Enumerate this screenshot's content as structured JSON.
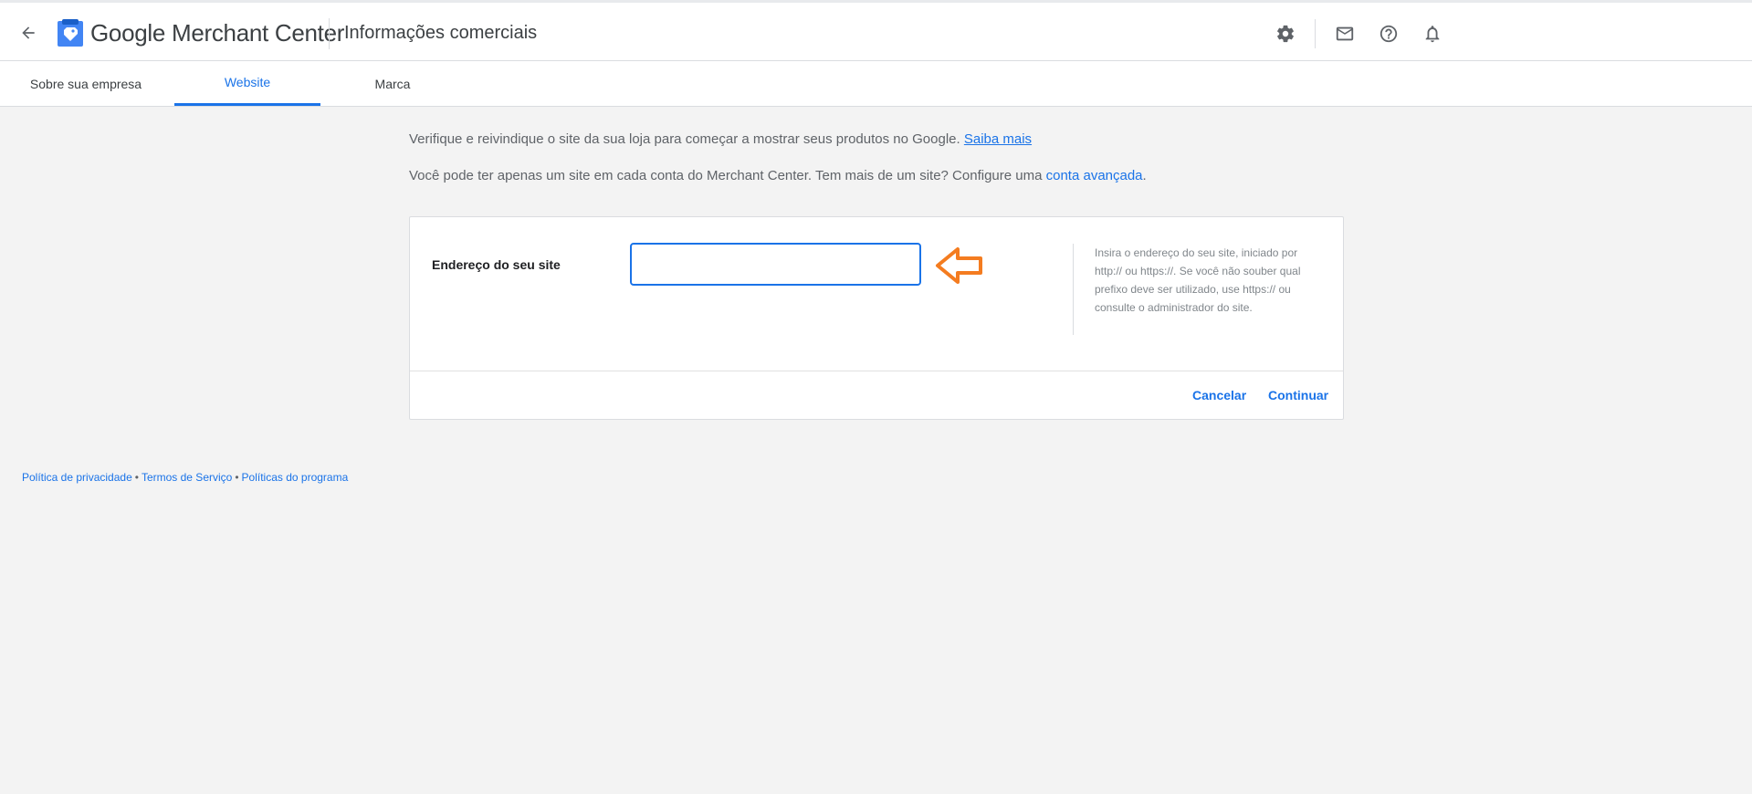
{
  "header": {
    "brand_google": "Google",
    "brand_product": "Merchant Center",
    "page_title": "Informações comerciais",
    "icons": [
      "arrow-back-icon",
      "merchant-center-logo-icon",
      "settings-icon",
      "mail-icon",
      "help-icon",
      "notifications-icon"
    ]
  },
  "tabs": [
    {
      "label": "Sobre sua empresa",
      "active": false
    },
    {
      "label": "Website",
      "active": true
    },
    {
      "label": "Marca",
      "active": false
    }
  ],
  "intro": {
    "line1_text": "Verifique e reivindique o site da sua loja para começar a mostrar seus produtos no Google.",
    "line1_link": "Saiba mais",
    "line2_text": "Você pode ter apenas um site em cada conta do Merchant Center. Tem mais de um site? Configure uma",
    "line2_link": "conta avançada",
    "line2_end": "."
  },
  "form": {
    "label": "Endereço do seu site",
    "input_value": "",
    "help_text": "Insira o endereço do seu site, iniciado por http:// ou https://. Se você não souber qual prefixo deve ser utilizado, use https:// ou consulte o administrador do site.",
    "cancel_label": "Cancelar",
    "continue_label": "Continuar"
  },
  "footer": {
    "privacy": "Política de privacidade",
    "terms": "Termos de Serviço",
    "policies": "Políticas do programa",
    "separator": "•"
  },
  "colors": {
    "accent": "#1a73e8",
    "annotation_arrow": "#f47c20",
    "background": "#f3f3f3"
  }
}
